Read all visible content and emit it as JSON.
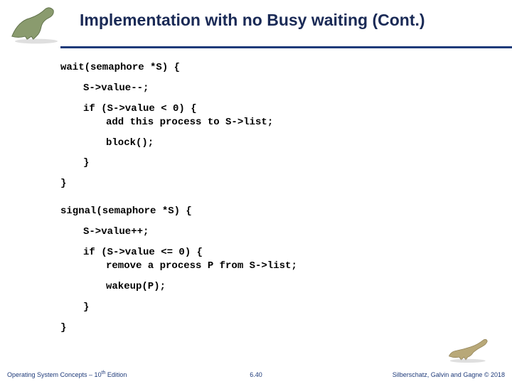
{
  "header": {
    "title": "Implementation with no Busy waiting (Cont.)"
  },
  "code": {
    "wait_sig": "wait(semaphore *S) {",
    "wait_dec": "S->value--;",
    "wait_if": "if (S->value < 0) {",
    "wait_add": "add this process to S->list;",
    "wait_block": "block();",
    "close_brace": "}",
    "signal_sig": "signal(semaphore *S) {",
    "signal_inc": "S->value++;",
    "signal_if": "if (S->value <= 0) {",
    "signal_remove": "remove a process P from S->list;",
    "signal_wakeup": "wakeup(P);"
  },
  "footer": {
    "left_prefix": "Operating System Concepts – 10",
    "left_sup": "th",
    "left_suffix": " Edition",
    "center": "6.40",
    "right": "Silberschatz, Galvin and Gagne © 2018"
  }
}
